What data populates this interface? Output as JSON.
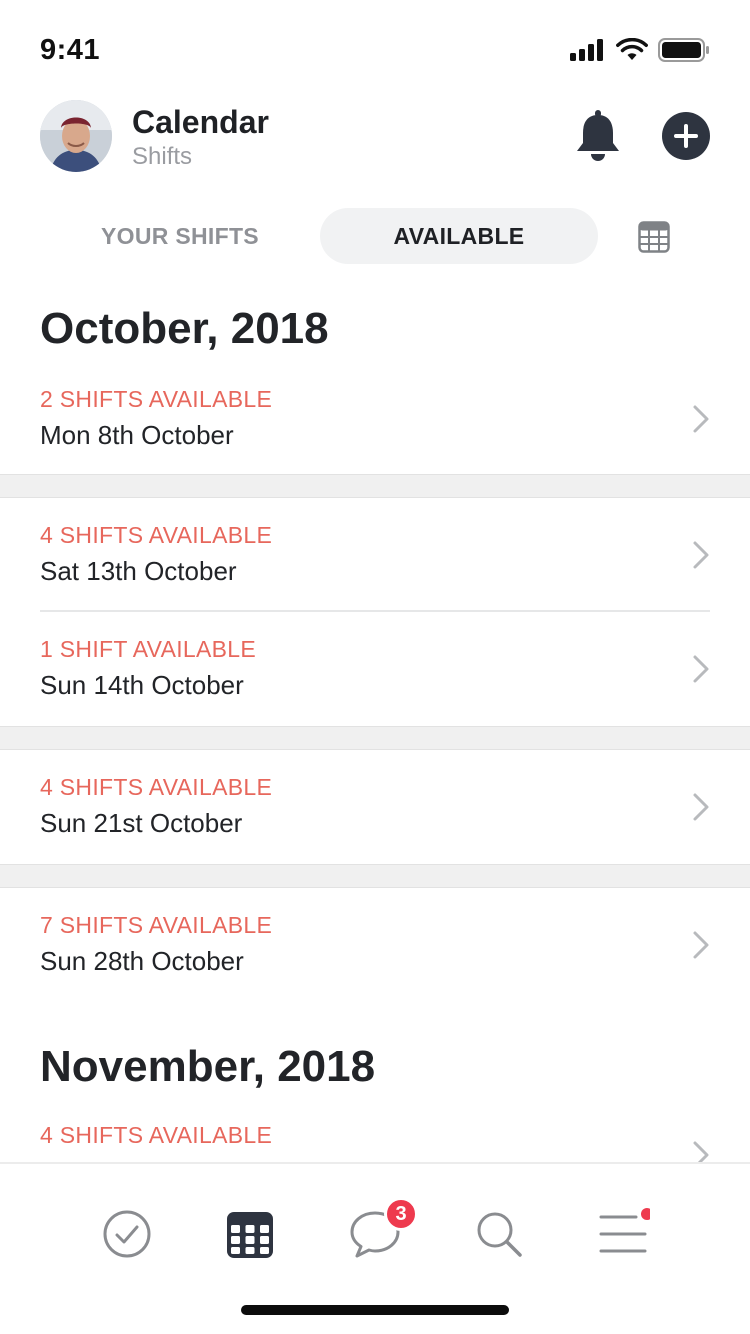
{
  "status_bar": {
    "time": "9:41"
  },
  "header": {
    "title": "Calendar",
    "subtitle": "Shifts",
    "icons": {
      "notifications": "bell-icon",
      "add": "plus-circle-icon"
    }
  },
  "tabs": {
    "your_shifts": "YOUR SHIFTS",
    "available": "AVAILABLE",
    "active": "available",
    "view_icon": "calendar-grid-icon"
  },
  "sections": [
    {
      "month": "October, 2018",
      "rows": [
        {
          "count": "2 SHIFTS AVAILABLE",
          "date": "Mon 8th October"
        },
        {
          "count": "4 SHIFTS AVAILABLE",
          "date": "Sat 13th October"
        },
        {
          "count": "1 SHIFT AVAILABLE",
          "date": "Sun 14th October"
        },
        {
          "count": "4 SHIFTS AVAILABLE",
          "date": "Sun 21st October"
        },
        {
          "count": "7 SHIFTS AVAILABLE",
          "date": "Sun 28th October"
        }
      ]
    },
    {
      "month": "November, 2018",
      "rows": [
        {
          "count": "4 SHIFTS AVAILABLE",
          "date": ""
        }
      ]
    }
  ],
  "tabbar": {
    "items": [
      {
        "name": "tasks",
        "icon": "check-circle-icon"
      },
      {
        "name": "calendar",
        "icon": "calendar-icon",
        "active": true
      },
      {
        "name": "messages",
        "icon": "chat-bubble-icon",
        "badge": "3"
      },
      {
        "name": "search",
        "icon": "search-icon"
      },
      {
        "name": "menu",
        "icon": "menu-icon",
        "dot": true
      }
    ]
  },
  "colors": {
    "accent_red": "#e7675c",
    "badge_red": "#ee3a4e",
    "dark": "#2e3440",
    "muted": "#8f9196"
  }
}
